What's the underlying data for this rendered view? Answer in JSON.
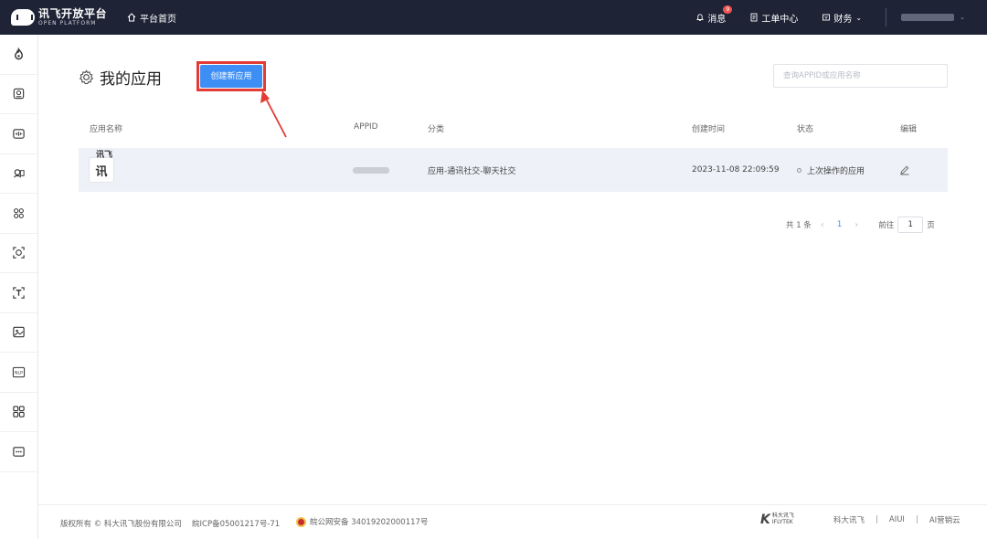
{
  "topbar": {
    "logo_main": "讯飞开放平台",
    "logo_sub": "OPEN PLATFORM",
    "home_label": "平台首页",
    "messages_label": "消息",
    "messages_badge": "9",
    "workorder_label": "工单中心",
    "finance_label": "财务"
  },
  "sidebar": {
    "icons": [
      "flame-icon",
      "voice-assistant-icon",
      "audio-icon",
      "speech-recognition-icon",
      "face-recognition-icon",
      "face-scan-icon",
      "text-recognition-icon",
      "image-icon",
      "nlp-icon",
      "apps-grid-icon",
      "more-icon"
    ],
    "nlp_text": "NLP"
  },
  "main": {
    "title": "我的应用",
    "create_button": "创建新应用",
    "search_placeholder": "查询APPID或应用名称"
  },
  "table": {
    "headers": {
      "name": "应用名称",
      "appid": "APPID",
      "category": "分类",
      "created": "创建时间",
      "status": "状态",
      "edit": "编辑"
    },
    "rows": [
      {
        "icon_char": "讯",
        "name": "讯飞",
        "category": "应用-通讯社交-聊天社交",
        "created": "2023-11-08 22:09:59",
        "status": "上次操作的应用"
      }
    ]
  },
  "pagination": {
    "total": "共 1 条",
    "current_page": "1",
    "goto_label": "前往",
    "goto_value": "1",
    "page_suffix": "页"
  },
  "footer": {
    "copyright": "版权所有 © 科大讯飞股份有限公司",
    "icp": "皖ICP备05001217号-71",
    "police": "皖公网安备 34019202000117号",
    "brand_mark": "K",
    "brand_cn": "科大讯飞",
    "brand_en": "IFLYTEK",
    "links": [
      "科大讯飞",
      "AIUI",
      "AI营销云"
    ]
  },
  "colors": {
    "topbar_bg": "#1e2436",
    "primary": "#3d8ff5",
    "highlight_box": "#e43b35",
    "annotation_arrow": "#e43b35",
    "row_bg": "#eef1f7"
  }
}
